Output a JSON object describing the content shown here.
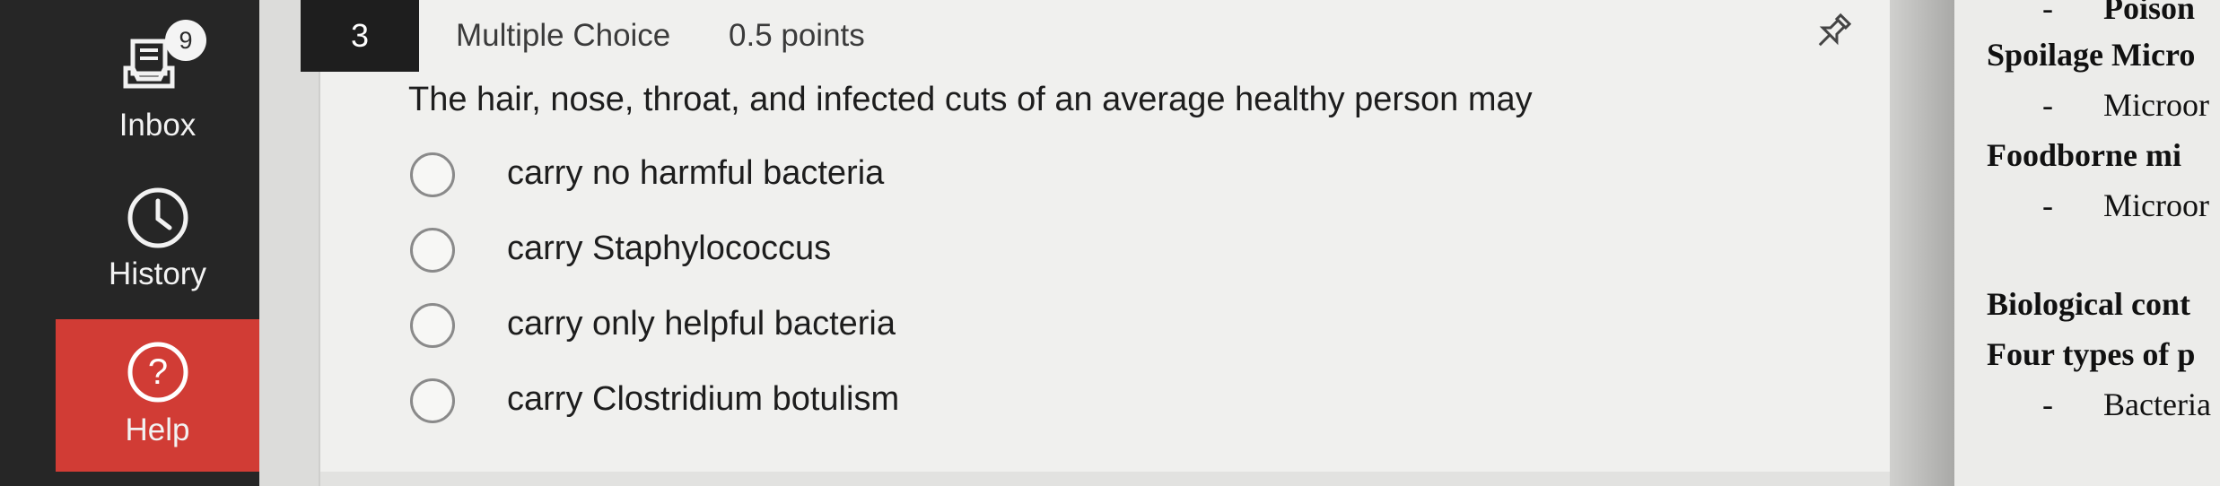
{
  "nav": {
    "inbox": {
      "label": "Inbox",
      "badge": "9",
      "icon": "inbox-icon"
    },
    "history": {
      "label": "History",
      "icon": "clock-icon"
    },
    "help": {
      "label": "Help",
      "icon": "help-question-icon",
      "color": "#d13c35"
    }
  },
  "question": {
    "number": "3",
    "type": "Multiple Choice",
    "points": "0.5 points",
    "pin_icon": "pin-icon",
    "text": "The hair, nose, throat, and infected cuts of an average healthy person may",
    "options": [
      "carry no harmful bacteria",
      "carry Staphylococcus",
      "carry only helpful bacteria",
      "carry Clostridium botulism"
    ]
  },
  "document": {
    "lines": [
      {
        "dash": "-",
        "text": "Poison"
      },
      {
        "heading": "Spoilage Micro"
      },
      {
        "dash": "-",
        "text": "Microor"
      },
      {
        "heading": "Foodborne mi"
      },
      {
        "dash": "-",
        "text": "Microor"
      },
      {
        "heading": "Biological cont"
      },
      {
        "heading": "Four types of p"
      },
      {
        "dash": "-",
        "text": "Bacteria"
      }
    ]
  }
}
